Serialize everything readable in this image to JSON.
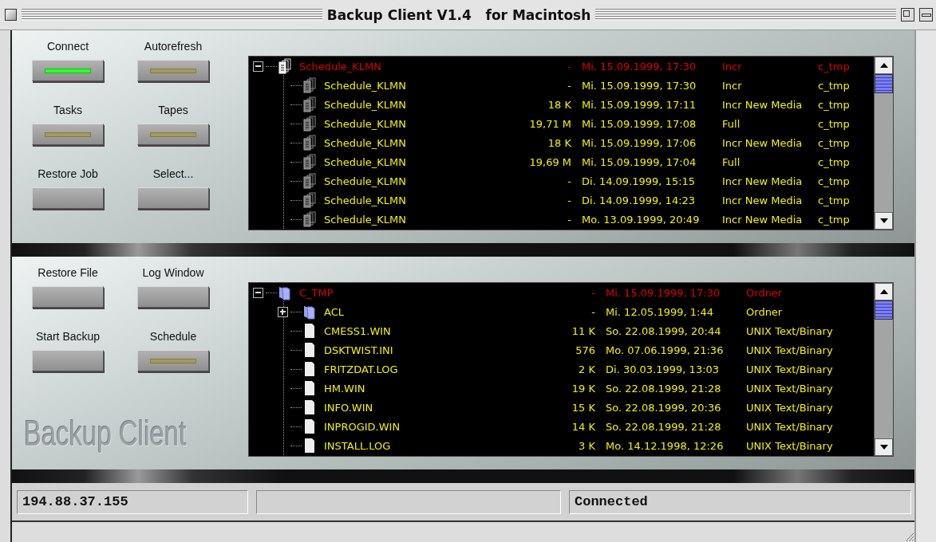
{
  "window": {
    "title": "Backup Client V1.4   for Macintosh"
  },
  "panels": [
    {
      "buttons": [
        {
          "label": "Connect",
          "kind": "lamp",
          "lit": true
        },
        {
          "label": "Autorefresh",
          "kind": "lamp",
          "lit": false
        },
        {
          "label": "Tasks",
          "kind": "lamp",
          "lit": false
        },
        {
          "label": "Tapes",
          "kind": "lamp",
          "lit": false
        },
        {
          "label": "Restore Job",
          "kind": "plain"
        },
        {
          "label": "Select...",
          "kind": "plain"
        }
      ],
      "list": {
        "rows": [
          {
            "kind": "schedule",
            "name": "Schedule_KLMN",
            "size": "-",
            "date": "Mi. 15.09.1999, 17:30",
            "type": "Incr",
            "target": "c_tmp",
            "selected": true,
            "expandable": true,
            "expanded": true,
            "children": [
              {
                "kind": "schedule",
                "name": "Schedule_KLMN",
                "size": "-",
                "date": "Mi. 15.09.1999, 17:30",
                "type": "Incr",
                "target": "c_tmp",
                "selected": false,
                "expandable": false
              },
              {
                "kind": "schedule",
                "name": "Schedule_KLMN",
                "size": "18 K",
                "date": "Mi. 15.09.1999, 17:11",
                "type": "Incr New Media",
                "target": "c_tmp",
                "selected": false,
                "expandable": false
              },
              {
                "kind": "schedule",
                "name": "Schedule_KLMN",
                "size": "19,71 M",
                "date": "Mi. 15.09.1999, 17:08",
                "type": "Full",
                "target": "c_tmp",
                "selected": false,
                "expandable": false
              },
              {
                "kind": "schedule",
                "name": "Schedule_KLMN",
                "size": "18 K",
                "date": "Mi. 15.09.1999, 17:06",
                "type": "Incr New Media",
                "target": "c_tmp",
                "selected": false,
                "expandable": false
              },
              {
                "kind": "schedule",
                "name": "Schedule_KLMN",
                "size": "19,69 M",
                "date": "Mi. 15.09.1999, 17:04",
                "type": "Full",
                "target": "c_tmp",
                "selected": false,
                "expandable": false
              },
              {
                "kind": "schedule",
                "name": "Schedule_KLMN",
                "size": "-",
                "date": "Di. 14.09.1999, 15:15",
                "type": "Incr New Media",
                "target": "c_tmp",
                "selected": false,
                "expandable": false
              },
              {
                "kind": "schedule",
                "name": "Schedule_KLMN",
                "size": "-",
                "date": "Di. 14.09.1999, 14:23",
                "type": "Incr New Media",
                "target": "c_tmp",
                "selected": false,
                "expandable": false
              },
              {
                "kind": "schedule",
                "name": "Schedule_KLMN",
                "size": "-",
                "date": "Mo. 13.09.1999, 20:49",
                "type": "Incr New Media",
                "target": "c_tmp",
                "selected": false,
                "expandable": false
              }
            ]
          }
        ]
      }
    },
    {
      "buttons": [
        {
          "label": "Restore File",
          "kind": "plain"
        },
        {
          "label": "Log Window",
          "kind": "plain"
        },
        {
          "label": "Start Backup",
          "kind": "plain"
        },
        {
          "label": "Schedule",
          "kind": "lamp",
          "lit": false
        }
      ],
      "logo": "Backup Client",
      "list": {
        "rows": [
          {
            "kind": "folder",
            "name": "C_TMP",
            "size": "-",
            "date": "Mi. 15.09.1999, 17:30",
            "type": "Ordner",
            "selected": true,
            "expandable": true,
            "expanded": true,
            "children": [
              {
                "kind": "folder",
                "name": "ACL",
                "size": "-",
                "date": "Mi. 12.05.1999, 1:44",
                "type": "Ordner",
                "selected": false,
                "expandable": true,
                "expanded": false
              },
              {
                "kind": "file",
                "name": "CMESS1.WIN",
                "size": "11 K",
                "date": "So. 22.08.1999, 20:44",
                "type": "UNIX Text/Binary",
                "selected": false,
                "expandable": false
              },
              {
                "kind": "file",
                "name": "DSKTWIST.INI",
                "size": "576",
                "date": "Mo. 07.06.1999, 21:36",
                "type": "UNIX Text/Binary",
                "selected": false,
                "expandable": false
              },
              {
                "kind": "file",
                "name": "FRITZDAT.LOG",
                "size": "2 K",
                "date": "Di. 30.03.1999, 13:03",
                "type": "UNIX Text/Binary",
                "selected": false,
                "expandable": false
              },
              {
                "kind": "file",
                "name": "HM.WIN",
                "size": "19 K",
                "date": "So. 22.08.1999, 21:28",
                "type": "UNIX Text/Binary",
                "selected": false,
                "expandable": false
              },
              {
                "kind": "file",
                "name": "INFO.WIN",
                "size": "15 K",
                "date": "So. 22.08.1999, 20:36",
                "type": "UNIX Text/Binary",
                "selected": false,
                "expandable": false
              },
              {
                "kind": "file",
                "name": "INPROGID.WIN",
                "size": "14 K",
                "date": "So. 22.08.1999, 21:28",
                "type": "UNIX Text/Binary",
                "selected": false,
                "expandable": false
              },
              {
                "kind": "file",
                "name": "INSTALL.LOG",
                "size": "3 K",
                "date": "Mo. 14.12.1998, 12:26",
                "type": "UNIX Text/Binary",
                "selected": false,
                "expandable": false
              }
            ]
          }
        ]
      }
    }
  ],
  "status_bar": {
    "address": "194.88.37.155",
    "state": "Connected"
  }
}
